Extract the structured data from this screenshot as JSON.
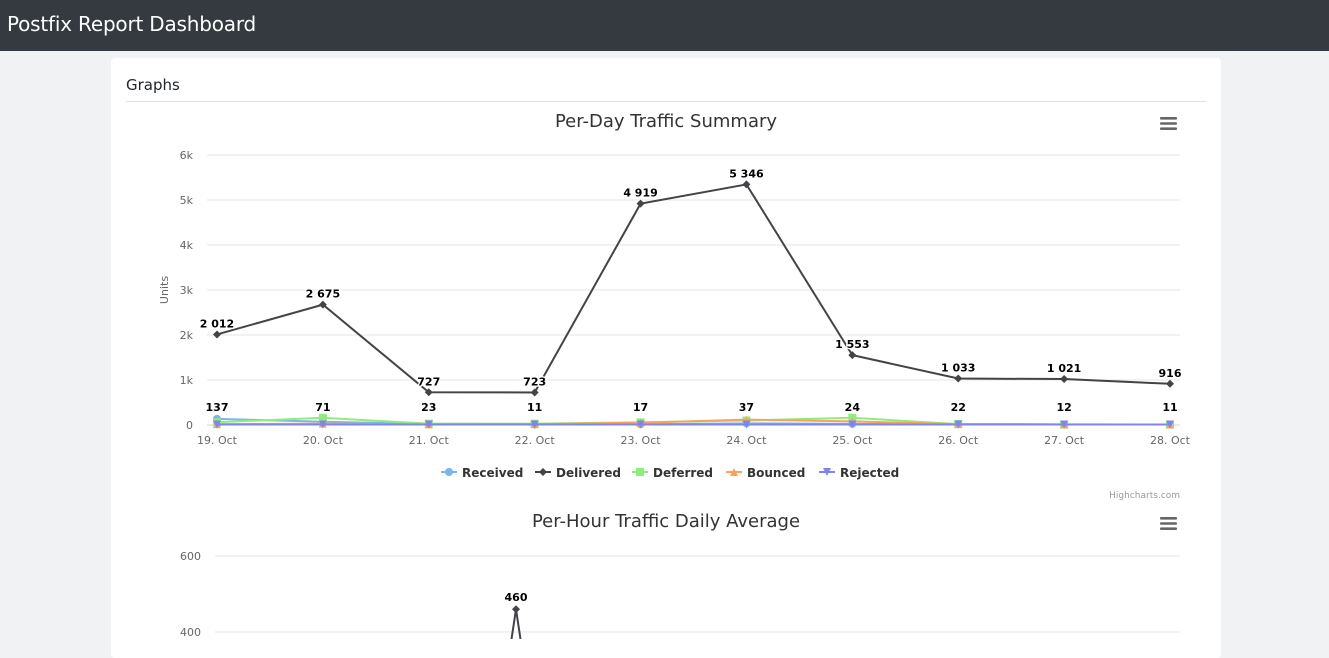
{
  "app": {
    "title": "Postfix Report Dashboard"
  },
  "card": {
    "header": "Graphs"
  },
  "icons": {
    "menu": "hamburger-menu-icon"
  },
  "colors": {
    "navbar": "#343a40",
    "received": "#7cb5ec",
    "delivered": "#434348",
    "deferred": "#90ed7d",
    "bounced": "#f7a35c",
    "rejected": "#8085e9"
  },
  "chart_data": [
    {
      "type": "line",
      "title": "Per-Day Traffic Summary",
      "ylabel": "Units",
      "xlabel": "",
      "categories": [
        "19. Oct",
        "20. Oct",
        "21. Oct",
        "22. Oct",
        "23. Oct",
        "24. Oct",
        "25. Oct",
        "26. Oct",
        "27. Oct",
        "28. Oct"
      ],
      "ylim": [
        0,
        6000
      ],
      "yticks": [
        "0",
        "1k",
        "2k",
        "3k",
        "4k",
        "5k",
        "6k"
      ],
      "grid": true,
      "legend_position": "bottom",
      "credit": "Highcharts.com",
      "series": [
        {
          "name": "Received",
          "marker": "circle",
          "values": [
            137,
            71,
            23,
            11,
            17,
            37,
            24,
            22,
            12,
            11
          ],
          "labels": []
        },
        {
          "name": "Delivered",
          "marker": "diamond",
          "values": [
            2012,
            2675,
            727,
            723,
            4919,
            5346,
            1553,
            1033,
            1021,
            916
          ],
          "labels": [
            "2 012",
            "2 675",
            "727",
            "723",
            "4 919",
            "5 346",
            "1 553",
            "1 033",
            "1 021",
            "916"
          ]
        },
        {
          "name": "Deferred",
          "marker": "square",
          "values": [
            60,
            160,
            30,
            30,
            60,
            100,
            160,
            20,
            10,
            10
          ],
          "labels": []
        },
        {
          "name": "Bounced",
          "marker": "triangle",
          "values": [
            20,
            30,
            15,
            20,
            50,
            120,
            80,
            20,
            15,
            10
          ],
          "labels": []
        },
        {
          "name": "Rejected",
          "marker": "triangle-down",
          "values": [
            10,
            10,
            10,
            10,
            10,
            10,
            10,
            10,
            10,
            10
          ],
          "labels": []
        }
      ],
      "top_labels": [
        "137",
        "71",
        "23",
        "11",
        "17",
        "37",
        "24",
        "22",
        "12",
        "11"
      ]
    },
    {
      "type": "line",
      "title": "Per-Hour Traffic Daily Average",
      "ylim": [
        0,
        600
      ],
      "yticks": [
        "400",
        "600"
      ],
      "grid": true,
      "visible_points": [
        {
          "x_index": 0,
          "value": 460,
          "label": "460"
        }
      ]
    }
  ]
}
